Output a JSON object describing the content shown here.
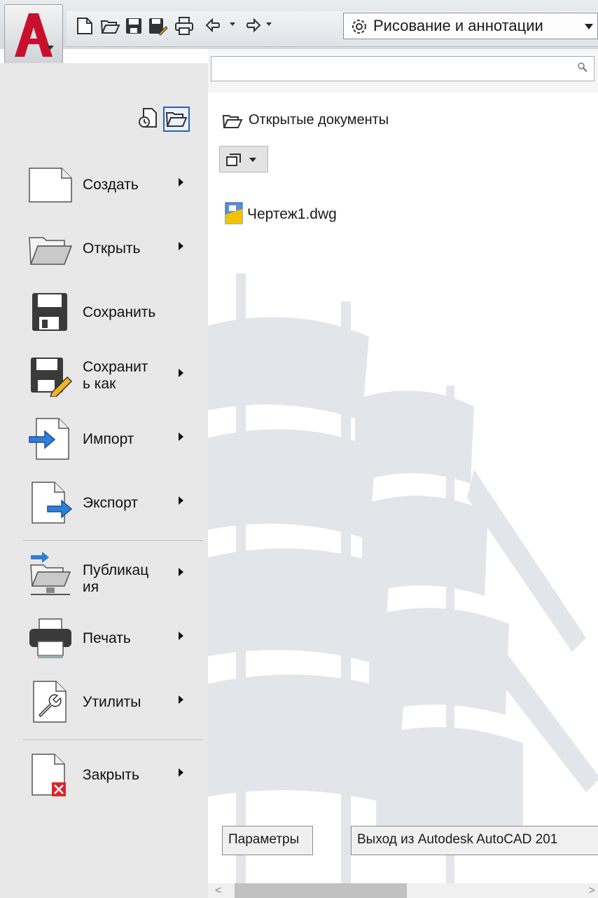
{
  "toolbar": {
    "app_icon": "autocad-a-icon",
    "workspace_label": "Рисование и аннотации"
  },
  "search": {
    "value": "",
    "placeholder": ""
  },
  "left_menu": {
    "items": [
      {
        "label": "Создать",
        "icon": "new-file-icon",
        "has_submenu": true
      },
      {
        "label": "Открыть",
        "icon": "open-folder-icon",
        "has_submenu": true
      },
      {
        "label": "Сохранить",
        "icon": "save-icon",
        "has_submenu": false
      },
      {
        "label": "Сохранит ь как",
        "icon": "save-as-icon",
        "has_submenu": true
      },
      {
        "label": "Импорт",
        "icon": "import-icon",
        "has_submenu": true
      },
      {
        "label": "Экспорт",
        "icon": "export-icon",
        "has_submenu": true
      },
      {
        "label": "Публикац ия",
        "icon": "publish-icon",
        "has_submenu": true
      },
      {
        "label": "Печать",
        "icon": "print-icon",
        "has_submenu": true
      },
      {
        "label": "Утилиты",
        "icon": "utilities-icon",
        "has_submenu": true
      },
      {
        "label": "Закрыть",
        "icon": "close-document-icon",
        "has_submenu": true
      }
    ]
  },
  "main": {
    "section_title": "Открытые документы",
    "documents": [
      {
        "name": "Чертеж1.dwg"
      }
    ]
  },
  "footer": {
    "options_label": "Параметры",
    "exit_label": "Выход из Autodesk AutoCAD 201"
  },
  "colors": {
    "accent": "#2d5fb5",
    "app_red": "#c8102e"
  }
}
